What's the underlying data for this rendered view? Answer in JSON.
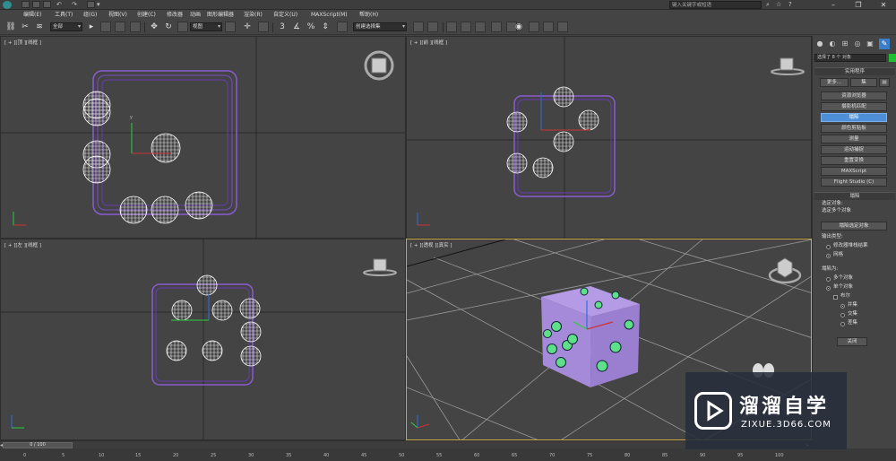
{
  "titlebar": {
    "search_placeholder": "键入关键字或短语"
  },
  "menu": {
    "items": [
      "编辑(E)",
      "工具(T)",
      "组(G)",
      "视图(V)",
      "创建(C)",
      "修改器",
      "动画",
      "图形编辑器",
      "渲染(R)",
      "自定义(U)",
      "MAXScript(M)",
      "帮助(H)"
    ]
  },
  "toolbar": {
    "filter_value": "全部",
    "refcoord_value": "视图",
    "selection_set_value": "创建选择集"
  },
  "viewports": {
    "top": "[ + ][顶 ][线框 ]",
    "front": "[ + ][前 ][线框 ]",
    "left": "[ + ][左 ][线框 ]",
    "perspective": "[ + ][透视 ][真实 ]"
  },
  "command_panel": {
    "name_field": "选择了 8 个 对象",
    "swatch_color": "#1fbf2f",
    "utilities_title": "实用程序",
    "more_label": "更多...",
    "sets_label": "集",
    "utilities": [
      "资源浏览器",
      "摄影机匹配",
      "塌陷",
      "颜色剪贴板",
      "测量",
      "运动捕捉",
      "重置变换",
      "MAXScript",
      "Flight Studio (C)"
    ],
    "collapse_title": "塌陷",
    "selected_label": "选定对象:",
    "selected_value": "选定多个对象",
    "collapse_selected_btn": "塌陷选定对象",
    "output_type_label": "输出类型:",
    "output_options": [
      "修改器堆栈结果",
      "网格"
    ],
    "collapse_to_label": "塌陷为:",
    "collapse_to_options": [
      "多个对象",
      "单个对象"
    ],
    "boolean_label": "布尔",
    "boolean_options": [
      "并集",
      "交集",
      "差集"
    ],
    "close_btn": "关闭"
  },
  "timeline": {
    "frame_display": "0 / 100",
    "ticks": [
      "0",
      "5",
      "10",
      "15",
      "20",
      "25",
      "30",
      "35",
      "40",
      "45",
      "50",
      "55",
      "60",
      "65",
      "70",
      "75",
      "80",
      "85",
      "90",
      "95",
      "100"
    ]
  },
  "watermark": {
    "title": "溜溜自学",
    "subtitle": "ZIXUE.3D66.COM"
  }
}
